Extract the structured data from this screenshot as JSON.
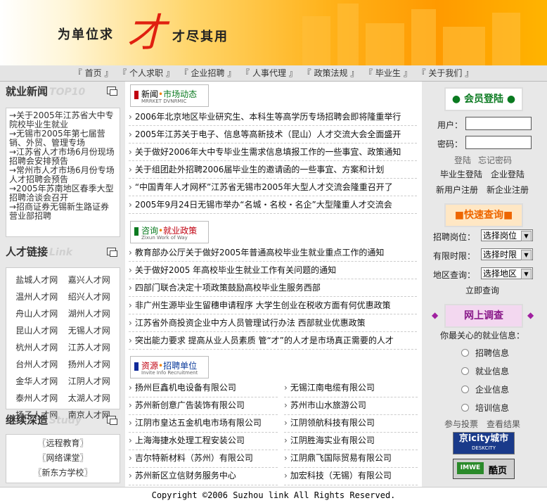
{
  "banner": {
    "slogan_left": "为单位求",
    "big_char": "才",
    "slogan_right": "才尽其用"
  },
  "nav": [
    "『 首页 』",
    "『 个人求职 』",
    "『 企业招聘 』",
    "『 人事代理 』",
    "『 政策法规 』",
    "『 毕业生 』",
    "『 关于我们 』"
  ],
  "left": {
    "news_title": "就业新闻",
    "news_ghost": "TOP10",
    "news": [
      "→关于2005年江苏省大中专院校毕业生就业",
      "→无锡市2005年第七届营销、外贸、管理专场",
      "→江苏省人才市场6月份现场招聘会安排预告",
      "→常州市人才市场6月份专场人才招聘会预告",
      "→2005年苏南地区春季大型招聘洽谈会召开",
      "→招商证券无锡新生路证券营业部招聘"
    ],
    "links_title": "人才链接",
    "links_ghost": "Link",
    "links": [
      "盐城人才网",
      "嘉兴人才网",
      "温州人才网",
      "绍兴人才网",
      "舟山人才网",
      "湖州人才网",
      "昆山人才网",
      "无锡人才网",
      "杭州人才网",
      "江苏人才网",
      "台州人才网",
      "扬州人才网",
      "金华人才网",
      "江阴人才网",
      "泰州人才网",
      "太湖人才网",
      "扬子人才网",
      "南京人才网"
    ],
    "study_title": "继续深造",
    "study_ghost": "Study",
    "study": [
      "〖远程教育〗",
      "〖网络课堂〗",
      "〖新东方学校〗"
    ]
  },
  "center": {
    "sec1": {
      "title_a": "新闻",
      "dot": "•",
      "title_b": "市场动态",
      "sub": "MRRKET DVNRMIC"
    },
    "sec1_rows": [
      "2006年北京地区毕业研究生、本科生等高学历专场招聘会即将隆重举行",
      "2005年江苏关于电子、信息等高新技术（昆山）人才交流大会全面盛开",
      "关于做好2006年大中专毕业生需求信息填报工作的一些事宜、政策通知",
      "关于组团赴外招聘2006届毕业生的邀请函的一些事宜、方案和计划",
      "“中国青年人才网杯”江苏省无锡市2005年大型人才交流会隆重召开了",
      "2005年9月24日无锡市举办“名城・名校・名企”大型隆重人才交流会"
    ],
    "sec2": {
      "title_a": "咨询",
      "dot": "•",
      "title_b": "就业政策",
      "sub": "Zixun Work of Way"
    },
    "sec2_rows": [
      "教育部办公厅关于做好2005年普通高校毕业生就业重点工作的通知",
      "关于做好2005 年高校毕业生就业工作有关问题的通知",
      "四部门联合决定十项政策鼓励高校毕业生服务西部",
      "非广州生源毕业生留穗申请程序 大学生创业在税收方面有何优惠政策",
      "江苏省外商投资企业中方人员管理试行办法 西部就业优惠政策",
      "突出能力要求 提高从业人员素质 管“才”的人才是市场真正需要的人才"
    ],
    "sec3": {
      "title_a": "资源",
      "dot": "•",
      "title_b": "招聘单位",
      "sub": "Invite Info Recruitment"
    },
    "sec3_left": [
      "扬州巨鑫机电设备有限公司",
      "苏州新创意广告装饰有限公司",
      "江阴市皇达五金机电市场有限公司",
      "上海海捷水处理工程安装公司",
      "吉尔特新材料（苏州）有限公司",
      "苏州新区立信财务服务中心"
    ],
    "sec3_right": [
      "无锡江南电缆有限公司",
      "苏州市山水旅游公司",
      "江阴领航科技有限公司",
      "江阴胜海实业有限公司",
      "江阴鼎飞国际贸易有限公司",
      "加宏科技（无锡）有限公司"
    ]
  },
  "right": {
    "login_title": "会员登陆",
    "user_label": "用户：",
    "pass_label": "密码：",
    "login_link": "登陆",
    "forgot_link": "忘记密码",
    "grad_login": "毕业生登陆",
    "company_login": "企业登陆",
    "new_user": "新用户注册",
    "new_company": "新企业注册",
    "query_title": "快速查询",
    "position_label": "招聘岗位：",
    "position_value": "选择岗位",
    "period_label": "有限时限：",
    "period_value": "选择时限",
    "region_label": "地区查询：",
    "region_value": "选择地区",
    "query_button": "立即查询",
    "survey_title": "网上调查",
    "survey_question": "你最关心的就业信息：",
    "survey_options": [
      "招聘信息",
      "就业信息",
      "企业信息",
      "培训信息"
    ],
    "vote_link": "参与投票",
    "result_link": "查看结果",
    "logo1": "京icity城市",
    "logo1_sub": "DESKCITY",
    "logo2_tag": "IMWE",
    "logo2": "酷页"
  },
  "footer": "Copyright ©2006 Suzhou link All Rights Reserved."
}
